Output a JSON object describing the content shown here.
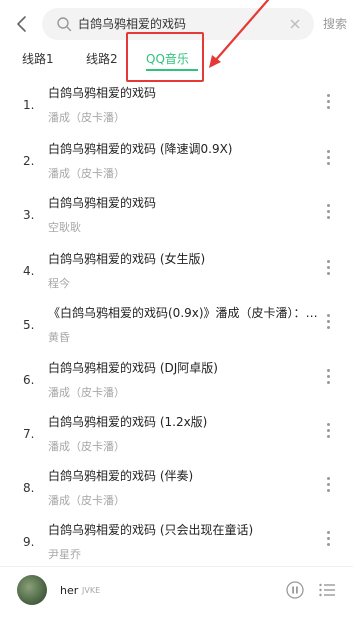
{
  "search": {
    "query": "白鸽乌鸦相爱的戏码",
    "search_label": "搜索"
  },
  "tabs": [
    {
      "label": "线路1"
    },
    {
      "label": "线路2"
    },
    {
      "label": "QQ音乐"
    }
  ],
  "songs": [
    {
      "index": "1.",
      "title": "白鸽乌鸦相爱的戏码",
      "artist": "潘成（皮卡潘）"
    },
    {
      "index": "2.",
      "title": "白鸽乌鸦相爱的戏码 (降速调0.9X)",
      "artist": "潘成（皮卡潘）"
    },
    {
      "index": "3.",
      "title": "白鸽乌鸦相爱的戏码",
      "artist": "空耿耿"
    },
    {
      "index": "4.",
      "title": "白鸽乌鸦相爱的戏码 (女生版)",
      "artist": "程今"
    },
    {
      "index": "5.",
      "title": "《白鸽乌鸦相爱的戏码(0.9x)》潘成（皮卡潘）：白鸽…",
      "artist": "黄昏"
    },
    {
      "index": "6.",
      "title": "白鸽乌鸦相爱的戏码 (DJ阿卓版)",
      "artist": "潘成（皮卡潘）"
    },
    {
      "index": "7.",
      "title": "白鸽乌鸦相爱的戏码 (1.2x版)",
      "artist": "潘成（皮卡潘）"
    },
    {
      "index": "8.",
      "title": "白鸽乌鸦相爱的戏码 (伴奏)",
      "artist": "潘成（皮卡潘）"
    },
    {
      "index": "9.",
      "title": "白鸽乌鸦相爱的戏码 (只会出现在童话)",
      "artist": "尹星乔"
    }
  ],
  "now_playing": {
    "title": "her",
    "artist": "JVKE"
  },
  "colors": {
    "accent": "#31c27c",
    "annotation": "#e53935"
  }
}
